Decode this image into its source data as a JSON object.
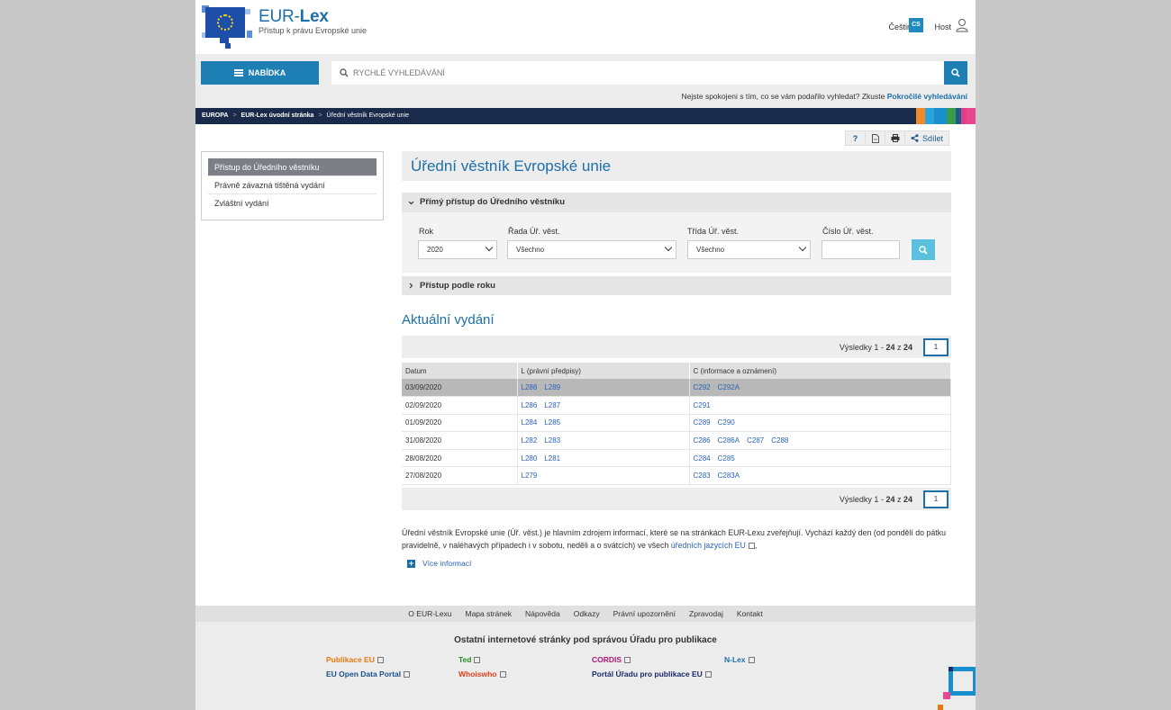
{
  "header": {
    "brand_prefix": "EUR-",
    "brand_bold": "Lex",
    "subtitle": "Přístup k právu Evropské unie",
    "language": "Čeština",
    "language_code": "CS",
    "user": "Host"
  },
  "search": {
    "menu_label": "NABÍDKA",
    "placeholder": "RYCHLÉ VYHLEDÁVÁNÍ",
    "hint_text": "Nejste spokojeni s tím, co se vám podařilo vyhledat? Zkuste ",
    "hint_link": "Pokročilé vyhledávání"
  },
  "breadcrumb": [
    "EUROPA",
    "EUR-Lex úvodní stránka",
    "Úřední věstník Evropské unie"
  ],
  "tools": {
    "help": "?",
    "share": "Sdílet"
  },
  "leftnav": [
    "Přístup do Úředního věstníku",
    "Právně závazná tištěná vydání",
    "Zvláštní vydání"
  ],
  "main": {
    "title": "Úřední věstník Evropské unie",
    "direct_access": "Přímý přístup do Úředního věstníku",
    "fields": {
      "year_label": "Rok",
      "year_value": "2020",
      "series_label": "Řada Úř. věst.",
      "series_value": "Všechno",
      "class_label": "Třída Úř. věst.",
      "class_value": "Všechno",
      "number_label": "Číslo Úř. věst."
    },
    "by_year": "Přístup podle roku",
    "current_title": "Aktuální vydání",
    "results_prefix": "Výsledky 1 - ",
    "results_count": "24",
    "results_of": " z ",
    "results_total": "24",
    "page": "1",
    "columns": [
      "Datum",
      "L (právní předpisy)",
      "C (informace a oznámení)"
    ],
    "rows": [
      {
        "date": "03/09/2020",
        "L": [
          "L288",
          "L289"
        ],
        "C": [
          "C292",
          "C292A"
        ]
      },
      {
        "date": "02/09/2020",
        "L": [
          "L286",
          "L287"
        ],
        "C": [
          "C291"
        ]
      },
      {
        "date": "01/09/2020",
        "L": [
          "L284",
          "L285"
        ],
        "C": [
          "C289",
          "C290"
        ]
      },
      {
        "date": "31/08/2020",
        "L": [
          "L282",
          "L283"
        ],
        "C": [
          "C286",
          "C286A",
          "C287",
          "C288"
        ]
      },
      {
        "date": "28/08/2020",
        "L": [
          "L280",
          "L281"
        ],
        "C": [
          "C284",
          "C285"
        ]
      },
      {
        "date": "27/08/2020",
        "L": [
          "L279"
        ],
        "C": [
          "C283",
          "C283A"
        ]
      }
    ],
    "desc_text": "Úřední věstník Evropské unie (Úř. věst.) je hlavním zdrojem informací, které se na stránkách EUR-Lexu zveřejňují. Vychází každý den (od pondělí do pátku pravidelně, v naléhavých případech i v sobotu, neděli a o svátcích) ve všech ",
    "desc_link": "úředních jazycích EU",
    "desc_end": ",",
    "more": "Více informací"
  },
  "footer": {
    "links": [
      "O EUR-Lexu",
      "Mapa stránek",
      "Nápověda",
      "Odkazy",
      "Právní upozornění",
      "Zpravodaj",
      "Kontakt"
    ],
    "other_title": "Ostatní internetové stránky pod správou Úřadu pro publikace",
    "sites": [
      {
        "name": "Publikace EU",
        "color": "#e8790c"
      },
      {
        "name": "Ted",
        "color": "#2a8a2a"
      },
      {
        "name": "CORDIS",
        "color": "#b0177a"
      },
      {
        "name": "N-Lex",
        "color": "#1d6fa8"
      },
      {
        "name": "EU Open Data Portal",
        "color": "#1d4f8c"
      },
      {
        "name": "Whoiswho",
        "color": "#e0401a"
      },
      {
        "name": "Portál Úřadu pro publikace EU",
        "color": "#1a2a6a"
      }
    ]
  }
}
